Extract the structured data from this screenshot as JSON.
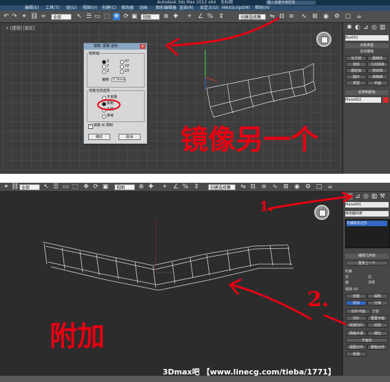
{
  "top": {
    "title_app": "Autodesk 3ds Max  2012 x64",
    "title_file": "无标题",
    "search_placeholder": "键入关键字或短语",
    "menus": [
      "编辑(E)",
      "工具(T)",
      "组(G)",
      "视图(V)",
      "创建(C)",
      "修改器",
      "动画",
      "图形编辑器",
      "渲染(R)",
      "自定义(U)",
      "MAXScript(M)",
      "帮助(H)"
    ],
    "toolbar": {
      "filter_value": "全部",
      "coord_value": "视图",
      "selection_set_value": "创建选择集"
    },
    "viewport_label": "+ [透视] [真实]",
    "command_panel": {
      "object_name": "Box001",
      "modifier_list": "修改器列表",
      "rollout_object_type": "对象类型",
      "auto_grid": "自动栅格",
      "buttons": [
        "长方体",
        "圆锥体",
        "球体",
        "几何球体",
        "圆柱体",
        "管状体",
        "圆环",
        "四棱锥",
        "茶壶",
        "平面"
      ],
      "rollout_name_color": "名称和颜色",
      "name_value": "Plane002"
    },
    "dialog": {
      "title": "镜像: 屏幕 坐标",
      "axis_group": "镜像轴:",
      "axes": [
        "X",
        "Y",
        "Z",
        "XY",
        "YZ",
        "ZX"
      ],
      "offset_label": "偏移:",
      "offset_value": "0.0mm",
      "clone_group": "克隆当前选择:",
      "clone_options": [
        "不克隆",
        "复制",
        "实例",
        "参考"
      ],
      "selected_clone_option": "复制",
      "mirror_ik": "镜像 IK 限制",
      "ok": "确定",
      "cancel": "取消"
    },
    "annotation": "镜像另一个"
  },
  "bottom": {
    "toolbar": {
      "filter_value": "全部",
      "coord_value": "视图",
      "selection_set_value": "创建选择集"
    },
    "command_panel": {
      "object_name": "Plane001",
      "modifier_list": "修改器列表",
      "stack_item": "可编辑多边形",
      "rollout_edit_geometry": "编辑几何体",
      "repeat_last": "重复上一个",
      "constraints_label": "约束",
      "constraint_none": "无",
      "constraint_edge": "边",
      "constraint_face": "面",
      "constraint_normal": "法线",
      "preserve_uv": "保持 UV",
      "create_button": "创建",
      "collapse_button": "塌陷",
      "attach_button": "附加",
      "detach_button": "分离",
      "slice_plane": "切片平面",
      "split": "分割",
      "slice": "切片",
      "reset_plane": "重置平面",
      "quickslice": "快速切片",
      "cut": "切割",
      "meshsmooth": "网格平滑",
      "tessellate": "细化",
      "planarize": "平面化",
      "view_align": "视图对齐",
      "grid_align": "栅格对齐",
      "relax": "松弛"
    },
    "annotation_main": "附加",
    "annotation_1": "1.",
    "annotation_2": "2."
  },
  "watermark": "3Dmax吧 【www.linecg.com/tieba/1771】",
  "colors": {
    "annotation_red": "#e60012",
    "viewport_bg": "#3d3d3d",
    "title_blue": "#16324a"
  }
}
